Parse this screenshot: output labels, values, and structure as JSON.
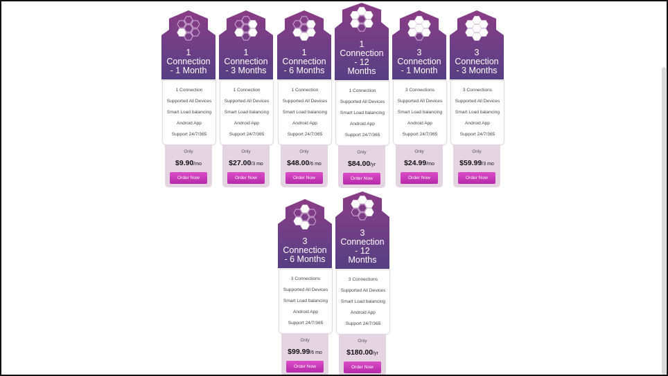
{
  "plans": [
    {
      "title": "1\nConnection\n- 1 Month",
      "features": [
        "1 Connection",
        "Supported All Devices",
        "Smart Load balancing",
        "Android App",
        "Support 24/7/365"
      ],
      "only": "Only",
      "price": "$9.90",
      "period": "/mo",
      "order": "Order Now"
    },
    {
      "title": "1\nConnection\n- 3 Months",
      "features": [
        "1 Connection",
        "Supported All Devices",
        "Smart Load balancing",
        "Android App",
        "Support 24/7/365"
      ],
      "only": "Only",
      "price": "$27.00",
      "period": "/3 mo",
      "order": "Order Now"
    },
    {
      "title": "1\nConnection\n- 6 Months",
      "features": [
        "1 Connection",
        "Supported All Devices",
        "Smart Load balancing",
        "Android App",
        "Support 24/7/365"
      ],
      "only": "Only",
      "price": "$48.00",
      "period": "/6 mo",
      "order": "Order Now"
    },
    {
      "title": "1\nConnection\n- 12\nMonths",
      "features": [
        "1 Connection",
        "Supported All Devices",
        "Smart Load balancing",
        "Android App",
        "Support 24/7/365"
      ],
      "only": "Only",
      "price": "$84.00",
      "period": "/yr",
      "order": "Order Now"
    },
    {
      "title": "3\nConnection\n- 1 Month",
      "features": [
        "3 Connections",
        "Supported All Devices",
        "Smart Load balancing",
        "Android App",
        "Support 24/7/365"
      ],
      "only": "Only",
      "price": "$24.99",
      "period": "/mo",
      "order": "Order Now"
    },
    {
      "title": "3\nConnection\n- 3 Months",
      "features": [
        "3 Connections",
        "Supported All Devices",
        "Smart Load balancing",
        "Android App",
        "Support 24/7/365"
      ],
      "only": "Only",
      "price": "$59.99",
      "period": "/3 mo",
      "order": "Order Now"
    },
    {
      "title": "3\nConnection\n- 6 Months",
      "features": [
        "3 Connections",
        "Supported All Devices",
        "Smart Load balancing",
        "Android App",
        "Support 24/7/365"
      ],
      "only": "Only",
      "price": "$99.99",
      "period": "/6 mo",
      "order": "Order Now"
    },
    {
      "title": "3\nConnection\n- 12\nMonths",
      "features": [
        "3 Connections",
        "Supported All Devices",
        "Smart Load balancing",
        "Android App",
        "Support 24/7/365"
      ],
      "only": "Only",
      "price": "$180.00",
      "period": "/yr",
      "order": "Order Now"
    }
  ]
}
